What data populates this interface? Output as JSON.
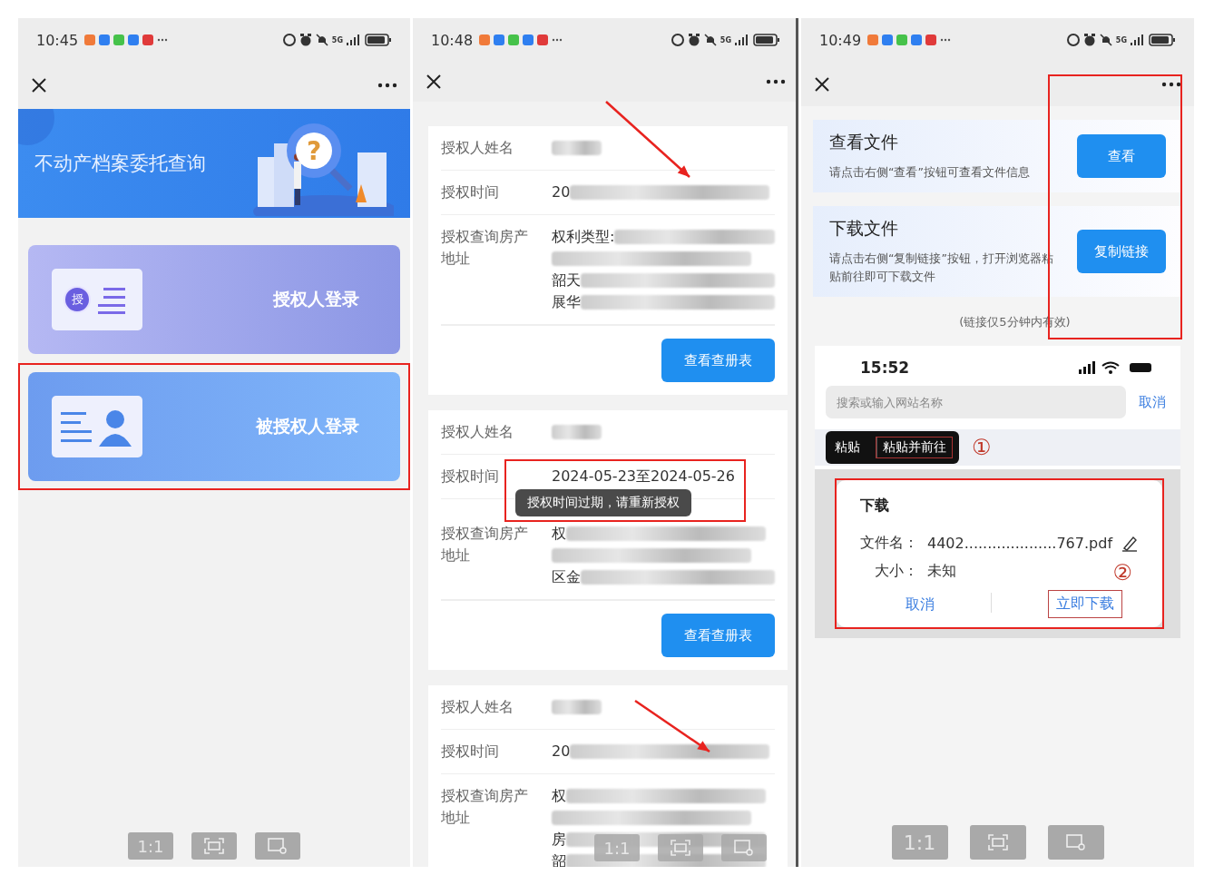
{
  "screens": [
    {
      "kind": "home",
      "status": {
        "time": "10:45",
        "network": "5G"
      },
      "banner": {
        "title": "不动产档案委托查询",
        "mark": "?"
      },
      "options": [
        {
          "kind": "certificate",
          "label": "授权人登录",
          "badge": "授",
          "highlighted": false
        },
        {
          "kind": "person",
          "label": "被授权人登录",
          "highlighted": true
        }
      ],
      "toolbar": {
        "zoom_label": "1:1"
      }
    },
    {
      "kind": "records",
      "status": {
        "time": "10:48",
        "network": "5G"
      },
      "records": [
        {
          "name_label": "授权人姓名",
          "time_label": "授权时间",
          "time_value": "20",
          "address_label": "授权查询房产地址",
          "address_lines": [
            "权利类型:",
            "韶天",
            "展华"
          ],
          "button": "查看查册表",
          "arrow": true
        },
        {
          "name_label": "授权人姓名",
          "time_label": "授权时间",
          "time_value": "2024-05-23至2024-05-26",
          "address_label": "授权查询房产地址",
          "address_lines": [
            "权",
            "区金"
          ],
          "button": "查看查册表",
          "arrow": false,
          "toast": "授权时间过期，请重新授权"
        },
        {
          "name_label": "授权人姓名",
          "time_label": "授权时间",
          "time_value": "20",
          "address_label": "授权查询房产地址",
          "address_lines": [
            "权",
            "房",
            "韶"
          ],
          "arrow": true
        }
      ],
      "toolbar": {
        "zoom_label": "1:1"
      }
    },
    {
      "kind": "download",
      "status": {
        "time": "10:49",
        "network": "5G"
      },
      "files": [
        {
          "title": "查看文件",
          "description": "请点击右侧“查看”按钮可查看文件信息",
          "button": "查看"
        },
        {
          "title": "下载文件",
          "description": "请点击右侧“复制链接”按钮，打开浏览器粘贴前往即可下载文件",
          "button": "复制链接"
        }
      ],
      "note": "(链接仅5分钟内有效)",
      "browser": {
        "time": "15:52",
        "search_placeholder": "搜索或输入网站名称",
        "cancel": "取消",
        "paste_menu": [
          "粘贴",
          "粘贴并前往"
        ],
        "step_one": "①",
        "dialog": {
          "title": "下载",
          "filename_label": "文件名：",
          "filename": "4402....................767.pdf",
          "size_label": "大小：",
          "size": "未知",
          "cancel": "取消",
          "confirm": "立即下载",
          "step_two": "②"
        }
      },
      "toolbar": {
        "zoom_label": "1:1"
      }
    }
  ]
}
